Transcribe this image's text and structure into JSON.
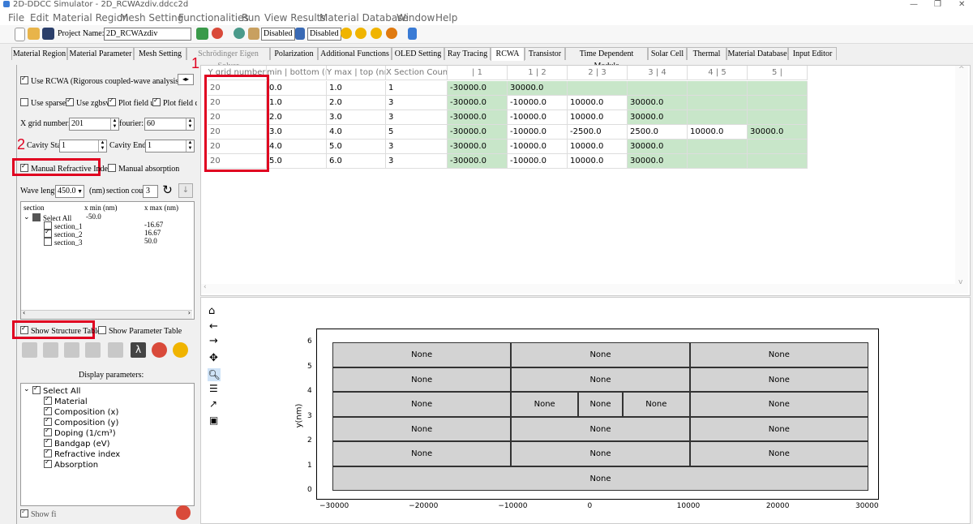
{
  "window": {
    "title": "2D-DDCC Simulator - 2D_RCWAzdiv.ddcc2d",
    "minimize": "—",
    "maximize": "❐",
    "close": "✕"
  },
  "menu": [
    "File",
    "Edit",
    "Material Region",
    "Mesh Setting",
    "Functionalities",
    "Run",
    "View Results",
    "Material Database",
    "Window",
    "Help"
  ],
  "toolbar": {
    "project_label": "Project Name:",
    "project_value": "2D_RCWAzdiv",
    "disabled1": "Disabled",
    "disabled2": "Disabled"
  },
  "tabs": [
    "Material Region",
    "Material Parameter",
    "Mesh Setting",
    "Schrödinger Eigen Solver",
    "Polarization",
    "Additional Functions",
    "OLED Setting",
    "Ray Tracing",
    "RCWA",
    "Transistor",
    "Time Dependent Module",
    "Solar Cell",
    "Thermal",
    "Material Database",
    "Input Editor"
  ],
  "left": {
    "use_rcwa": "Use RCWA (Rigorous coupled-wave analysis)",
    "use_sparse": "Use sparse",
    "use_zgbsv": "Use zgbsv",
    "plot_field_u": "Plot field u",
    "plot_field_d": "Plot field d",
    "x_grid_label": "X grid number:",
    "x_grid_value": "201",
    "fourier_label": "fourier:",
    "fourier_value": "60",
    "cavity_start_label": "Cavity Start:",
    "cavity_start_value": "1",
    "cavity_end_label": "Cavity End:",
    "cavity_end_value": "1",
    "manual_refractive": "Manual Refractive Index",
    "manual_absorption": "Manual absorption",
    "wavelength_label": "Wave lengt",
    "wavelength_value": "450.0",
    "nm_label": "(nm)",
    "section_count_label": "section coun",
    "section_count_value": "3",
    "section_tree": {
      "col1": "section",
      "col2": "x min (nm)",
      "col3": "x max (nm)",
      "select_all": "Select All",
      "select_all_min": "-50.0",
      "rows": [
        {
          "name": "section_1",
          "max": "-16.67"
        },
        {
          "name": "section_2",
          "max": "16.67"
        },
        {
          "name": "section_3",
          "max": "50.0"
        }
      ]
    },
    "show_structure_table": "Show Structure Table",
    "show_parameter_table": "Show Parameter Table",
    "display_params_title": "Display parameters:",
    "display_params": [
      "Select All",
      "Material",
      "Composition (x)",
      "Composition (y)",
      "Doping (1/cm³)",
      "Bandgap (eV)",
      "Refractive index",
      "Absorption"
    ],
    "bottom_label": "Show fi"
  },
  "annotations": {
    "one": "1",
    "two": "2"
  },
  "table": {
    "headers": [
      "Y grid number",
      "min | bottom (nr",
      "Y max | top (nm)",
      "X Section Count",
      "| 1",
      "1 | 2",
      "2 | 3",
      "3 | 4",
      "4 | 5",
      "5 |"
    ],
    "rows": [
      [
        "20",
        "0.0",
        "1.0",
        "1",
        "-30000.0",
        "30000.0",
        "",
        "",
        "",
        ""
      ],
      [
        "20",
        "1.0",
        "2.0",
        "3",
        "-30000.0",
        "-10000.0",
        "10000.0",
        "30000.0",
        "",
        ""
      ],
      [
        "20",
        "2.0",
        "3.0",
        "3",
        "-30000.0",
        "-10000.0",
        "10000.0",
        "30000.0",
        "",
        ""
      ],
      [
        "20",
        "3.0",
        "4.0",
        "5",
        "-30000.0",
        "-10000.0",
        "-2500.0",
        "2500.0",
        "10000.0",
        "30000.0"
      ],
      [
        "20",
        "4.0",
        "5.0",
        "3",
        "-30000.0",
        "-10000.0",
        "10000.0",
        "30000.0",
        "",
        ""
      ],
      [
        "20",
        "5.0",
        "6.0",
        "3",
        "-30000.0",
        "-10000.0",
        "10000.0",
        "30000.0",
        "",
        ""
      ]
    ]
  },
  "plot": {
    "ylabel": "y(nm)",
    "xticks": [
      "−30000",
      "−20000",
      "−10000",
      "0",
      "10000",
      "20000",
      "30000"
    ],
    "yticks": [
      "0",
      "1",
      "2",
      "3",
      "4",
      "5",
      "6"
    ],
    "cell_label": "None"
  },
  "chart_data": {
    "type": "table",
    "ylabel": "y(nm)",
    "xlim": [
      -30000,
      30000
    ],
    "ylim": [
      0,
      6
    ],
    "layers": [
      {
        "y": [
          0,
          1
        ],
        "x_bounds": [
          -30000,
          30000
        ],
        "labels": [
          "None"
        ]
      },
      {
        "y": [
          1,
          2
        ],
        "x_bounds": [
          -30000,
          -10000,
          10000,
          30000
        ],
        "labels": [
          "None",
          "None",
          "None"
        ]
      },
      {
        "y": [
          2,
          3
        ],
        "x_bounds": [
          -30000,
          -10000,
          10000,
          30000
        ],
        "labels": [
          "None",
          "None",
          "None"
        ]
      },
      {
        "y": [
          3,
          4
        ],
        "x_bounds": [
          -30000,
          -10000,
          -2500,
          2500,
          10000,
          30000
        ],
        "labels": [
          "None",
          "None",
          "None",
          "None",
          "None"
        ]
      },
      {
        "y": [
          4,
          5
        ],
        "x_bounds": [
          -30000,
          -10000,
          10000,
          30000
        ],
        "labels": [
          "None",
          "None",
          "None"
        ]
      },
      {
        "y": [
          5,
          6
        ],
        "x_bounds": [
          -30000,
          -10000,
          10000,
          30000
        ],
        "labels": [
          "None",
          "None",
          "None"
        ]
      }
    ]
  },
  "colors": {
    "green_cell": "#c8e6c9",
    "highlight": "#e00020",
    "plot_cell": "#d3d3d3"
  }
}
